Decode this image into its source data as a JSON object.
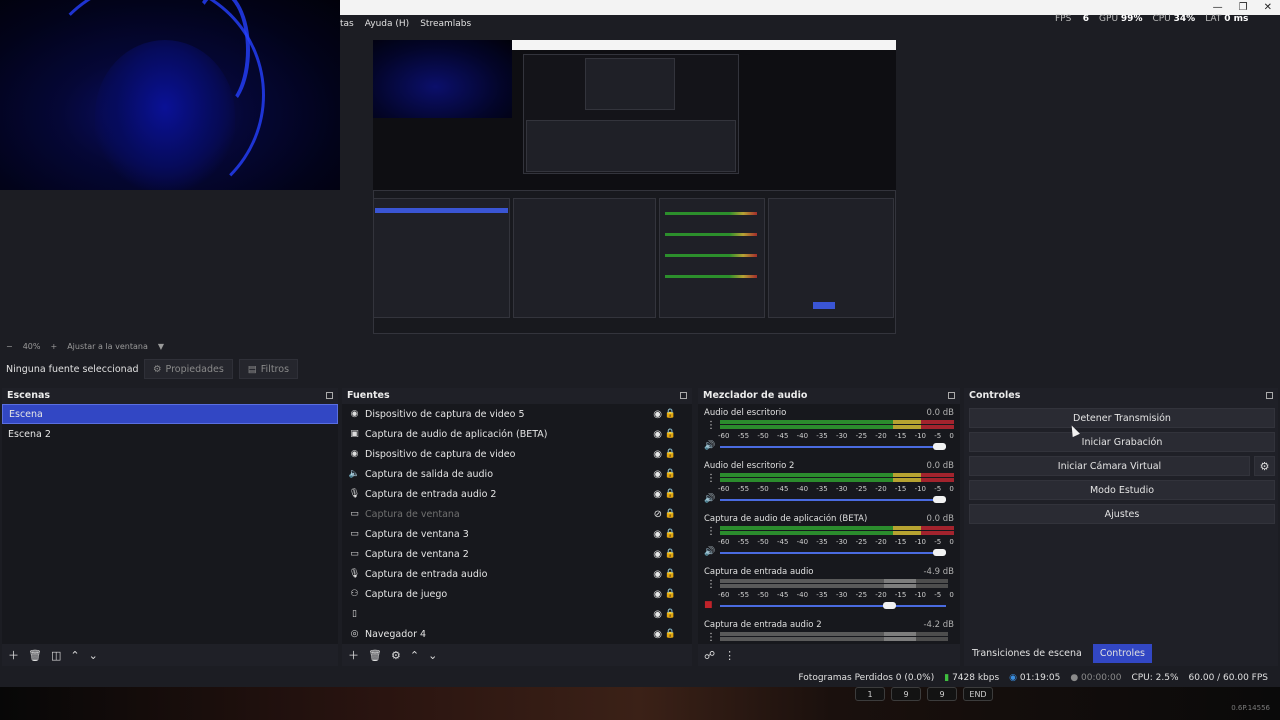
{
  "menu": {
    "items": [
      "tas",
      "Ayuda (H)",
      "Streamlabs"
    ]
  },
  "stats": {
    "fps_label": "FPS",
    "fps_value": "6",
    "gpu_label": "GPU",
    "gpu_value": "99%",
    "cpu_label": "CPU",
    "cpu_value": "34%",
    "lat_label": "LAT",
    "lat_value": "0 ms"
  },
  "zoom": {
    "minus": "−",
    "value": "40%",
    "plus": "+",
    "fit": "Ajustar a la ventana"
  },
  "source_toolbar": {
    "selection": "Ninguna fuente seleccionada",
    "properties": "Propiedades",
    "filters": "Filtros"
  },
  "scenes": {
    "title": "Escenas",
    "items": [
      {
        "label": "Escena",
        "active": true
      },
      {
        "label": "Escena 2",
        "active": false
      }
    ]
  },
  "sources": {
    "title": "Fuentes",
    "items": [
      {
        "label": "Dispositivo de captura de video 5",
        "icon": "camera-icon",
        "state": "normal"
      },
      {
        "label": "Captura de audio de aplicación (BETA)",
        "icon": "app-audio-icon",
        "state": "normal"
      },
      {
        "label": "Dispositivo de captura de video",
        "icon": "camera-icon",
        "state": "normal"
      },
      {
        "label": "Captura de salida de audio",
        "icon": "speaker-icon",
        "state": "normal"
      },
      {
        "label": "Captura de entrada audio 2",
        "icon": "microphone-icon",
        "state": "normal"
      },
      {
        "label": "Captura de ventana",
        "icon": "window-icon",
        "state": "hidden"
      },
      {
        "label": "Captura de ventana 3",
        "icon": "window-icon",
        "state": "normal"
      },
      {
        "label": "Captura de ventana 2",
        "icon": "window-icon",
        "state": "normal"
      },
      {
        "label": "Captura de entrada audio",
        "icon": "microphone-icon",
        "state": "normal"
      },
      {
        "label": "Captura de juego",
        "icon": "gamepad-icon",
        "state": "normal"
      },
      {
        "label": "",
        "icon": "file-icon",
        "state": "error"
      },
      {
        "label": "Navegador 4",
        "icon": "globe-icon",
        "state": "normal"
      }
    ]
  },
  "mixer": {
    "title": "Mezclador de audio",
    "ticks": [
      "-60",
      "-55",
      "-50",
      "-45",
      "-40",
      "-35",
      "-30",
      "-25",
      "-20",
      "-15",
      "-10",
      "-5",
      "0"
    ],
    "channels": [
      {
        "name": "Audio del escritorio",
        "db": "0.0 dB",
        "level": 1.0,
        "volume": 1.0,
        "muted": false,
        "active": true
      },
      {
        "name": "Audio del escritorio 2",
        "db": "0.0 dB",
        "level": 1.0,
        "volume": 1.0,
        "muted": false,
        "active": true
      },
      {
        "name": "Captura de audio de aplicación (BETA)",
        "db": "0.0 dB",
        "level": 1.0,
        "volume": 1.0,
        "muted": false,
        "active": true
      },
      {
        "name": "Captura de entrada audio",
        "db": "-4.9 dB",
        "level": 0.85,
        "volume": 0.78,
        "muted": true,
        "active": false
      },
      {
        "name": "Captura de entrada audio 2",
        "db": "-4.2 dB",
        "level": 0.86,
        "volume": 0.8,
        "muted": false,
        "active": false
      }
    ]
  },
  "controls": {
    "title": "Controles",
    "stop_stream": "Detener Transmisión",
    "start_record": "Iniciar Grabación",
    "virtual_cam": "Iniciar Cámara Virtual",
    "studio_mode": "Modo Estudio",
    "settings": "Ajustes",
    "tabs": [
      "Transiciones de escena",
      "Controles"
    ]
  },
  "status": {
    "dropped": "Fotogramas Perdidos 0 (0.0%)",
    "bitrate": "7428 kbps",
    "stream_time": "01:19:05",
    "rec_time": "00:00:00",
    "cpu": "CPU: 2.5%",
    "fps": "60.00 / 60.00 FPS"
  },
  "keyboard": [
    "1",
    "9",
    "9",
    "END"
  ],
  "version": "0.6P.14556",
  "colors": {
    "accent": "#3247c4",
    "meter_green": "#2b8c2d",
    "meter_yellow": "#b7a331",
    "meter_red": "#a3232d",
    "error_text": "#b2201f"
  }
}
